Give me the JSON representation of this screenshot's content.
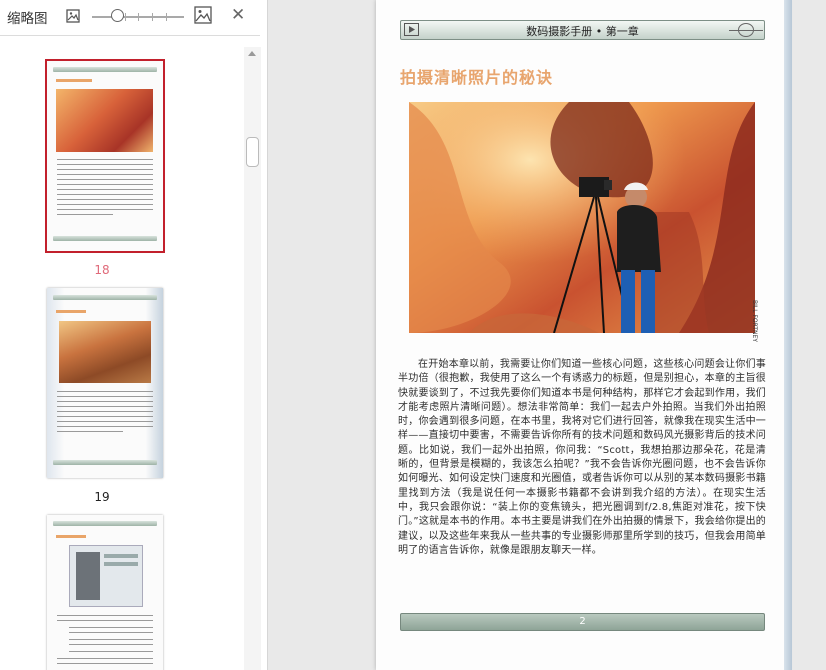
{
  "thumbnail_panel": {
    "title": "缩略图",
    "icons": [
      "image-small-icon",
      "image-large-icon",
      "close-icon"
    ],
    "zoom_level": 0.25,
    "thumbnails": [
      {
        "page_label": "18",
        "selected": true,
        "color": "#e06a7a"
      },
      {
        "page_label": "19",
        "selected": false,
        "color": "#222222"
      },
      {
        "page_label": "",
        "selected": false,
        "color": "#222222"
      }
    ]
  },
  "page": {
    "header": "数码摄影手册 • 第一章",
    "chapter_title": "拍摄清晰照片的秘诀",
    "photo_credit": "BILL FORTNEY",
    "body": "在开始本章以前，我需要让你们知道一些核心问题，这些核心问题会让你们事半功倍（很抱歉，我使用了这么一个有诱惑力的标题，但是别担心，本章的主旨很快就要谈到了，不过我先要你们知道本书是何种结构，那样它才会起到作用，我们才能考虑照片清晰问题）。想法非常简单：我们一起去户外拍照。当我们外出拍照时，你会遇到很多问题，在本书里，我将对它们进行回答，就像我在现实生活中一样——直接切中要害，不需要告诉你所有的技术问题和数码风光摄影背后的技术问题。比如说，我们一起外出拍照，你问我：“Scott，我想拍那边那朵花，花是清晰的，但背景是模糊的，我该怎么拍呢？”我不会告诉你光圈问题，也不会告诉你如何曝光、如何设定快门速度和光圈值，或者告诉你可以从别的某本数码摄影书籍里找到方法（我是说任何一本摄影书籍都不会讲到我介绍的方法）。在现实生活中，我只会跟你说：“装上你的变焦镜头，把光圈调到f/2.8,焦距对准花，按下快门。”这就是本书的作用。本书主要是讲我们在外出拍摄的情景下，我会给你提出的建议，以及这些年来我从一些共事的专业摄影师那里所学到的技巧，但我会用简单明了的语言告诉你，就像是跟朋友聊天一样。",
    "page_number": "2",
    "accent_color": "#e8a56e"
  }
}
